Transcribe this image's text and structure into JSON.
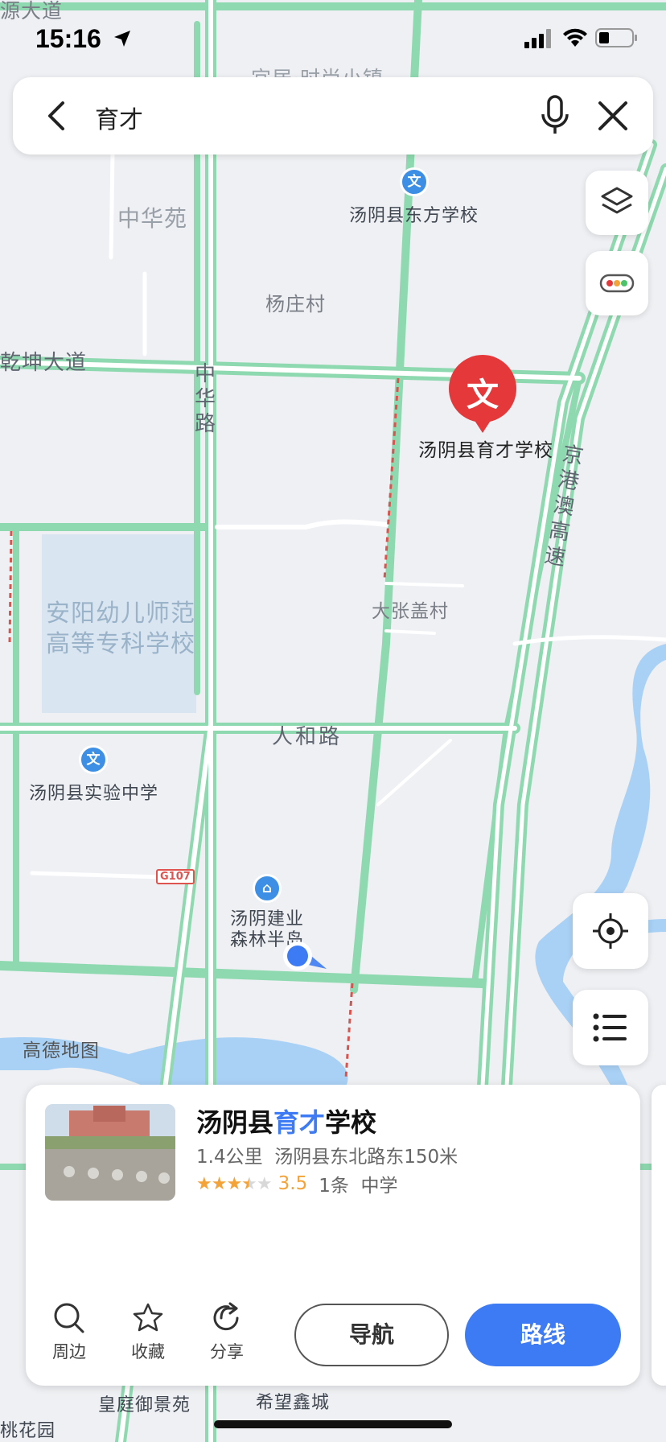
{
  "status_bar": {
    "time": "15:16"
  },
  "search": {
    "query": "育才"
  },
  "map": {
    "labels": {
      "zhonghuayuan": "中华苑",
      "dongfang_school": "汤阴县东方学校",
      "yangzhuang": "杨庄村",
      "qiankun_road": "乾坤大道",
      "zhonghua_road": "中华路",
      "yucai_school": "汤阴县育才学校",
      "expressway": "京港澳高速",
      "kindergarten_college": "安阳幼儿师范高等专科学校",
      "dazhang": "大张盖村",
      "renhe_road": "人和路",
      "shiyan_school": "汤阴县实验中学",
      "g107": "G107",
      "jianye": "汤阴建业森林半岛",
      "amap": "高德地图",
      "huangting": "皇庭御景苑",
      "xiwang": "希望鑫城",
      "taohua": "桃花园",
      "shishang": "宜居·时尚小镇",
      "yuan_road": "源大道",
      "poi_marker": "文",
      "house_marker": "⌂"
    }
  },
  "card": {
    "title_before": "汤阴县",
    "title_highlight": "育才",
    "title_after": "学校",
    "distance": "1.4公里",
    "address": "汤阴县东北路东150米",
    "rating": "3.5",
    "reviews": "1条",
    "category": "中学",
    "actions": {
      "nearby": "周边",
      "favorite": "收藏",
      "share": "分享"
    },
    "nav_button": "导航",
    "route_button": "路线"
  },
  "colors": {
    "accent": "#3d7bf5",
    "marker": "#e5383b",
    "road": "#8fd9b0"
  }
}
